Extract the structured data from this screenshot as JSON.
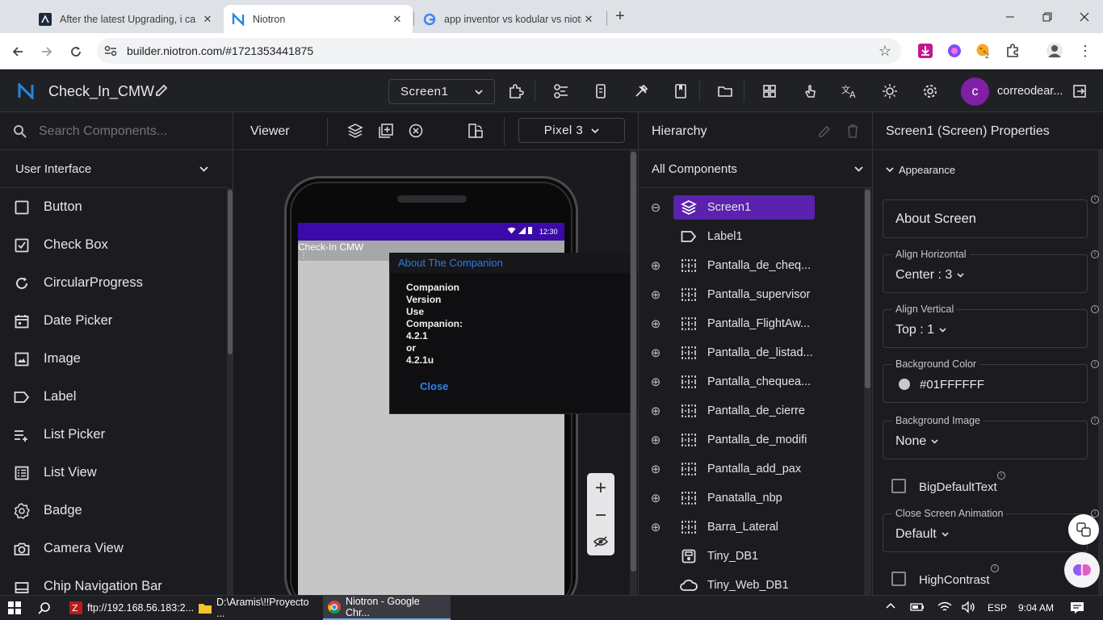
{
  "browser": {
    "tabs": [
      {
        "title": "After the latest Upgrading, i ca",
        "active": false
      },
      {
        "title": "Niotron",
        "active": true
      },
      {
        "title": "app inventor vs kodular vs niotr",
        "active": false
      }
    ],
    "url": "builder.niotron.com/#1721353441875",
    "ext_badge": "2"
  },
  "app": {
    "project_name": "Check_In_CMW",
    "screen_select": "Screen1",
    "user_initial": "c",
    "user_name": "correodear..."
  },
  "palette": {
    "search_placeholder": "Search Components...",
    "category": "User Interface",
    "items": [
      {
        "label": "Button",
        "icon": "square-outline-icon"
      },
      {
        "label": "Check Box",
        "icon": "checkbox-icon"
      },
      {
        "label": "CircularProgress",
        "icon": "circular-progress-icon"
      },
      {
        "label": "Date Picker",
        "icon": "calendar-icon"
      },
      {
        "label": "Image",
        "icon": "image-icon"
      },
      {
        "label": "Label",
        "icon": "label-tag-icon"
      },
      {
        "label": "List Picker",
        "icon": "list-add-icon"
      },
      {
        "label": "List View",
        "icon": "list-view-icon"
      },
      {
        "label": "Badge",
        "icon": "badge-icon"
      },
      {
        "label": "Camera View",
        "icon": "camera-icon"
      },
      {
        "label": "Chip Navigation Bar",
        "icon": "nav-bar-icon"
      }
    ]
  },
  "viewer": {
    "title": "Viewer",
    "device": "Pixel 3",
    "status_time": "12:30",
    "app_title": "Check-In CMW",
    "app_menu_glyph": "⋮"
  },
  "dialog": {
    "title": "About The Companion",
    "lines": [
      "Companion",
      "Version",
      "Use",
      "Companion:",
      "4.2.1",
      "or",
      "4.2.1u"
    ],
    "close_label": "Close"
  },
  "hierarchy": {
    "title": "Hierarchy",
    "filter": "All Components",
    "items": [
      {
        "label": "Screen1",
        "icon": "layers-icon",
        "expander": "⊖",
        "level": 0,
        "selected": true
      },
      {
        "label": "Label1",
        "icon": "label-tag-icon",
        "expander": "",
        "level": 1,
        "selected": false
      },
      {
        "label": "Pantalla_de_cheq...",
        "icon": "arrangement-icon",
        "expander": "⊕",
        "level": 1,
        "selected": false
      },
      {
        "label": "Pantalla_supervisor",
        "icon": "arrangement-icon",
        "expander": "⊕",
        "level": 1,
        "selected": false
      },
      {
        "label": "Pantalla_FlightAw...",
        "icon": "arrangement-icon",
        "expander": "⊕",
        "level": 1,
        "selected": false
      },
      {
        "label": "Pantalla_de_listad...",
        "icon": "arrangement-icon",
        "expander": "⊕",
        "level": 1,
        "selected": false
      },
      {
        "label": "Pantalla_chequea...",
        "icon": "arrangement-icon",
        "expander": "⊕",
        "level": 1,
        "selected": false
      },
      {
        "label": "Pantalla_de_cierre",
        "icon": "arrangement-icon",
        "expander": "⊕",
        "level": 1,
        "selected": false
      },
      {
        "label": "Pantalla_de_modifi",
        "icon": "arrangement-icon",
        "expander": "⊕",
        "level": 1,
        "selected": false
      },
      {
        "label": "Pantalla_add_pax",
        "icon": "arrangement-icon",
        "expander": "⊕",
        "level": 1,
        "selected": false
      },
      {
        "label": "Panatalla_nbp",
        "icon": "arrangement-icon",
        "expander": "⊕",
        "level": 1,
        "selected": false
      },
      {
        "label": "Barra_Lateral",
        "icon": "arrangement-icon",
        "expander": "⊕",
        "level": 1,
        "selected": false
      },
      {
        "label": "Tiny_DB1",
        "icon": "database-icon",
        "expander": "",
        "level": 1,
        "selected": false
      },
      {
        "label": "Tiny_Web_DB1",
        "icon": "cloud-icon",
        "expander": "",
        "level": 1,
        "selected": false
      }
    ]
  },
  "properties": {
    "title": "Screen1 (Screen) Properties",
    "section": "Appearance",
    "about_screen": "About Screen",
    "align_horizontal": {
      "label": "Align Horizontal",
      "value": "Center : 3"
    },
    "align_vertical": {
      "label": "Align Vertical",
      "value": "Top : 1"
    },
    "background_color": {
      "label": "Background Color",
      "value": "#01FFFFFF"
    },
    "background_image": {
      "label": "Background Image",
      "value": "None"
    },
    "big_default_text": "BigDefaultText",
    "close_screen_animation": {
      "label": "Close Screen Animation",
      "value": "Default"
    },
    "high_contrast": "HighContrast"
  },
  "taskbar": {
    "apps": [
      {
        "label": "ftp://192.168.56.183:2..."
      },
      {
        "label": "D:\\Aramis\\!!Proyecto ..."
      },
      {
        "label": "Niotron - Google Chr..."
      }
    ],
    "lang": "ESP",
    "time": "9:04 AM"
  },
  "colors": {
    "accent": "#5b21b6",
    "selected_node": "#5b22b0",
    "link_blue": "#1a73e8",
    "dark_bg": "#1c1c20"
  }
}
